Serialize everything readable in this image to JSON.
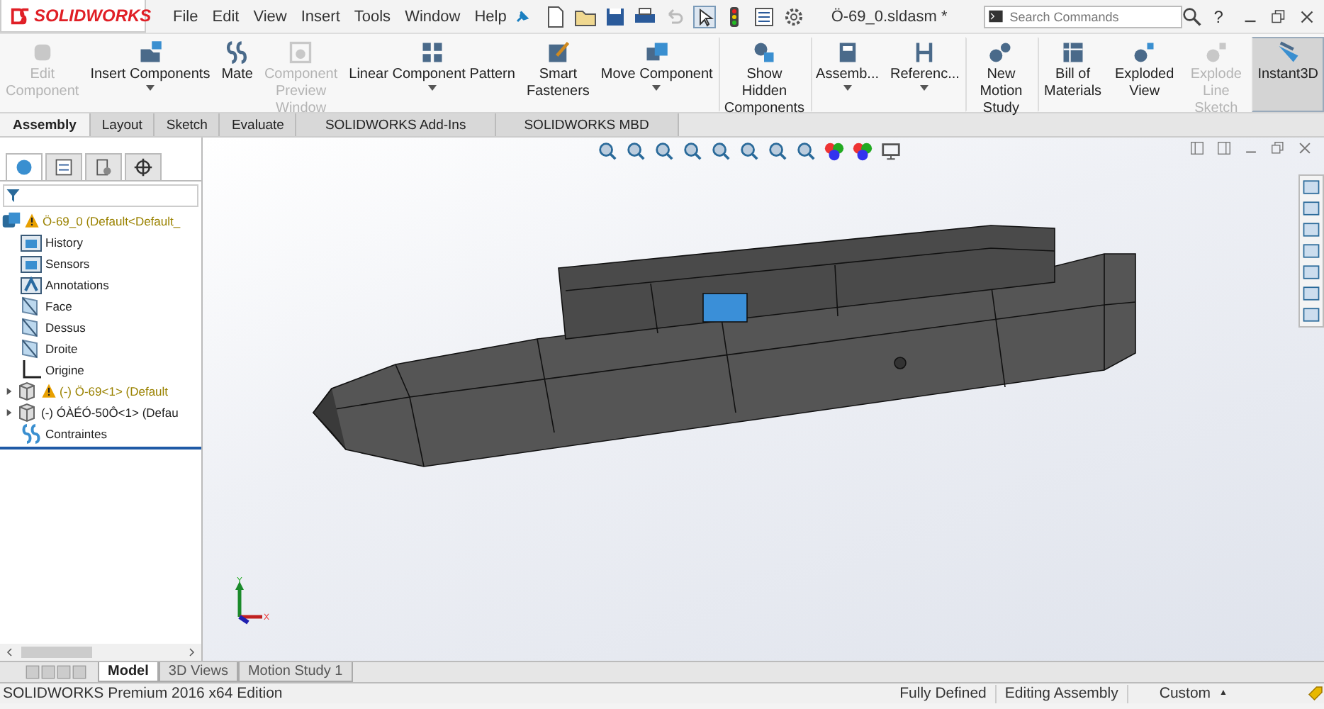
{
  "app": {
    "logo": "SOLIDWORKS",
    "menus": [
      "File",
      "Edit",
      "View",
      "Insert",
      "Tools",
      "Window",
      "Help"
    ],
    "document_title": "Ö-69_0.sldasm *",
    "search": {
      "placeholder": "Search Commands"
    },
    "help": "?"
  },
  "ribbon": [
    {
      "label": "Edit Component",
      "kind": "stacked",
      "disabled": true,
      "dropdown": false,
      "selected": false
    },
    {
      "label": "Insert Components",
      "kind": "wide",
      "disabled": false,
      "dropdown": true,
      "selected": false
    },
    {
      "label": "Mate",
      "kind": "stacked",
      "disabled": false,
      "dropdown": false,
      "selected": false
    },
    {
      "label": "Component Preview Window",
      "kind": "stacked",
      "disabled": true,
      "dropdown": false,
      "selected": false
    },
    {
      "label": "Linear Component Pattern",
      "kind": "wide",
      "disabled": false,
      "dropdown": true,
      "selected": false
    },
    {
      "label": "Smart Fasteners",
      "kind": "stacked",
      "disabled": false,
      "dropdown": false,
      "selected": false
    },
    {
      "label": "Move Component",
      "kind": "wide",
      "disabled": false,
      "dropdown": true,
      "selected": false
    },
    {
      "label": "Show Hidden Components",
      "kind": "stacked",
      "disabled": false,
      "dropdown": false,
      "selected": false
    },
    {
      "label": "Assemb...",
      "kind": "wide",
      "disabled": false,
      "dropdown": true,
      "selected": false
    },
    {
      "label": "Referenc...",
      "kind": "wide",
      "disabled": false,
      "dropdown": true,
      "selected": false
    },
    {
      "label": "New Motion Study",
      "kind": "stacked",
      "disabled": false,
      "dropdown": false,
      "selected": false
    },
    {
      "label": "Bill of Materials",
      "kind": "stacked",
      "disabled": false,
      "dropdown": false,
      "selected": false
    },
    {
      "label": "Exploded View",
      "kind": "stacked",
      "disabled": false,
      "dropdown": false,
      "selected": false
    },
    {
      "label": "Explode Line Sketch",
      "kind": "stacked",
      "disabled": true,
      "dropdown": false,
      "selected": false
    },
    {
      "label": "Instant3D",
      "kind": "stacked",
      "disabled": false,
      "dropdown": false,
      "selected": true
    }
  ],
  "tabs": [
    {
      "label": "Assembly",
      "selected": true
    },
    {
      "label": "Layout",
      "selected": false
    },
    {
      "label": "Sketch",
      "selected": false
    },
    {
      "label": "Evaluate",
      "selected": false
    },
    {
      "label": "SOLIDWORKS Add-Ins",
      "selected": false
    },
    {
      "label": "SOLIDWORKS MBD",
      "selected": false
    }
  ],
  "tree": {
    "label": "Ö-69_0  (Default<Default_",
    "warning": true,
    "children": [
      {
        "label": "History",
        "kind": "folder",
        "warning": false
      },
      {
        "label": "Sensors",
        "kind": "folder",
        "warning": false
      },
      {
        "label": "Annotations",
        "kind": "annotation",
        "warning": false
      },
      {
        "label": "Face",
        "kind": "plane",
        "warning": false
      },
      {
        "label": "Dessus",
        "kind": "plane",
        "warning": false
      },
      {
        "label": "Droite",
        "kind": "plane",
        "warning": false
      },
      {
        "label": "Origine",
        "kind": "origin",
        "warning": false
      },
      {
        "label": "(-) Ö-69<1> (Default",
        "kind": "part",
        "warning": true,
        "expanded": false
      },
      {
        "label": "(-) ÓÀÉÓ-50Ô<1> (Defau",
        "kind": "part",
        "warning": false,
        "expanded": false
      },
      {
        "label": "Contraintes",
        "kind": "mates",
        "warning": false
      }
    ]
  },
  "triad": {
    "y": "Y",
    "x": "X"
  },
  "bottom_tabs": [
    {
      "label": "Model",
      "selected": true
    },
    {
      "label": "3D Views",
      "selected": false
    },
    {
      "label": "Motion Study 1",
      "selected": false
    }
  ],
  "status_bar": {
    "edition": "SOLIDWORKS Premium 2016 x64 Edition",
    "state": "Fully Defined",
    "mode": "Editing Assembly",
    "units": "Custom",
    "units_caret": "▲"
  }
}
